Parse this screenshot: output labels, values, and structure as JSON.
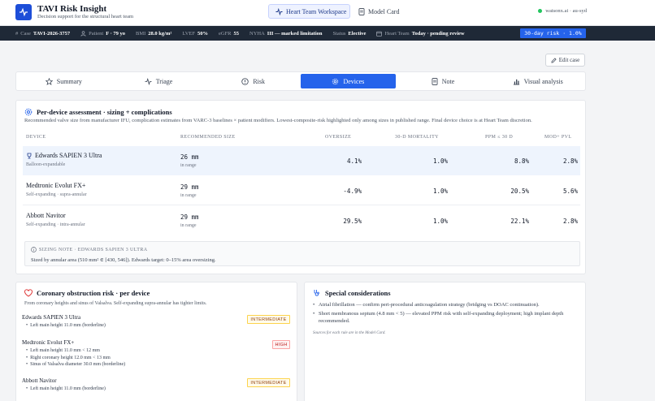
{
  "app": {
    "title": "TAVI Risk Insight",
    "subtitle": "Decision support for the structural heart team",
    "workspace_label": "Heart Team Workspace",
    "model_card_label": "Model Card",
    "host": "watsonx.ai · au-syd",
    "accent": "#2563eb"
  },
  "case": {
    "case_k": "Case",
    "case_v": "TAVI-2026-3757",
    "patient_k": "Patient",
    "patient_v": "F · 79 yo",
    "bmi_k": "BMI",
    "bmi_v": "28.0 kg/m²",
    "lvef_k": "LVEF",
    "lvef_v": "50%",
    "egfr_k": "eGFR",
    "egfr_v": "55",
    "nyha_k": "NYHA",
    "nyha_v": "III — marked limitation",
    "status_k": "Status",
    "status_v": "Elective",
    "team_k": "Heart Team",
    "team_v": "Today · pending review",
    "risk_pill": "30-day risk · 1.0%"
  },
  "edit_label": "Edit case",
  "tabs": [
    {
      "label": "Summary",
      "icon": "star-icon"
    },
    {
      "label": "Triage",
      "icon": "activity-icon"
    },
    {
      "label": "Risk",
      "icon": "alert-circle-icon"
    },
    {
      "label": "Devices",
      "icon": "gear-icon",
      "active": true
    },
    {
      "label": "Note",
      "icon": "document-icon"
    },
    {
      "label": "Visual analysis",
      "icon": "bar-chart-icon"
    }
  ],
  "devices": {
    "title": "Per-device assessment · sizing + complications",
    "description": "Recommended valve size from manufacturer IFU, complication estimates from VARC-3 baselines × patient modifiers. Lowest-composite-risk highlighted only among sizes in published range. Final device choice is at Heart Team discretion.",
    "headers": {
      "device": "Device",
      "size": "Recommended size",
      "oversize": "Oversize",
      "mortality": "30-d mortality",
      "ppm": "PPM ≤ 30 d",
      "pvl": "Mod+ PVL"
    },
    "rows": [
      {
        "name": "Edwards SAPIEN 3 Ultra",
        "type": "Balloon-expandable",
        "size": "26 mm",
        "range": "in range",
        "oversize": "4.1%",
        "mortality": "1.0%",
        "ppm": "8.8%",
        "pvl": "2.8%",
        "highlight": true
      },
      {
        "name": "Medtronic Evolut FX+",
        "type": "Self-expanding · supra-annular",
        "size": "29 mm",
        "range": "in range",
        "oversize": "-4.9%",
        "mortality": "1.0%",
        "ppm": "20.5%",
        "pvl": "5.6%",
        "highlight": false
      },
      {
        "name": "Abbott Navitor",
        "type": "Self-expanding · intra-annular",
        "size": "29 mm",
        "range": "in range",
        "oversize": "29.5%",
        "mortality": "1.0%",
        "ppm": "22.1%",
        "pvl": "2.8%",
        "highlight": false
      }
    ],
    "note_header": "Sizing note · Edwards SAPIEN 3 Ultra",
    "note_text": "Sized by annular area (510 mm² ∈ [430, 546]). Edwards target: 0–15% area oversizing."
  },
  "coronary": {
    "title": "Coronary obstruction risk · per device",
    "description": "From coronary heights and sinus of Valsalva. Self-expanding supra-annular has tighter limits.",
    "items": [
      {
        "device": "Edwards SAPIEN 3 Ultra",
        "badge": "INTERMEDIATE",
        "level": "int",
        "bullets": [
          "Left main height 11.0 mm (borderline)"
        ]
      },
      {
        "device": "Medtronic Evolut FX+",
        "badge": "HIGH",
        "level": "high",
        "bullets": [
          "Left main height 11.0 mm < 12 mm",
          "Right coronary height 12.0 mm < 13 mm",
          "Sinus of Valsalva diameter 30.0 mm (borderline)"
        ]
      },
      {
        "device": "Abbott Navitor",
        "badge": "INTERMEDIATE",
        "level": "int",
        "bullets": [
          "Left main height 11.0 mm (borderline)"
        ]
      }
    ]
  },
  "special": {
    "title": "Special considerations",
    "items": [
      "Atrial fibrillation — confirm peri-procedural anticoagulation strategy (bridging vs DOAC continuation).",
      "Short membranous septum (4.8 mm < 5) — elevated PPM risk with self-expanding deployment; high implant depth recommended."
    ],
    "footnote": "Sources for each rule are in the Model Card."
  }
}
